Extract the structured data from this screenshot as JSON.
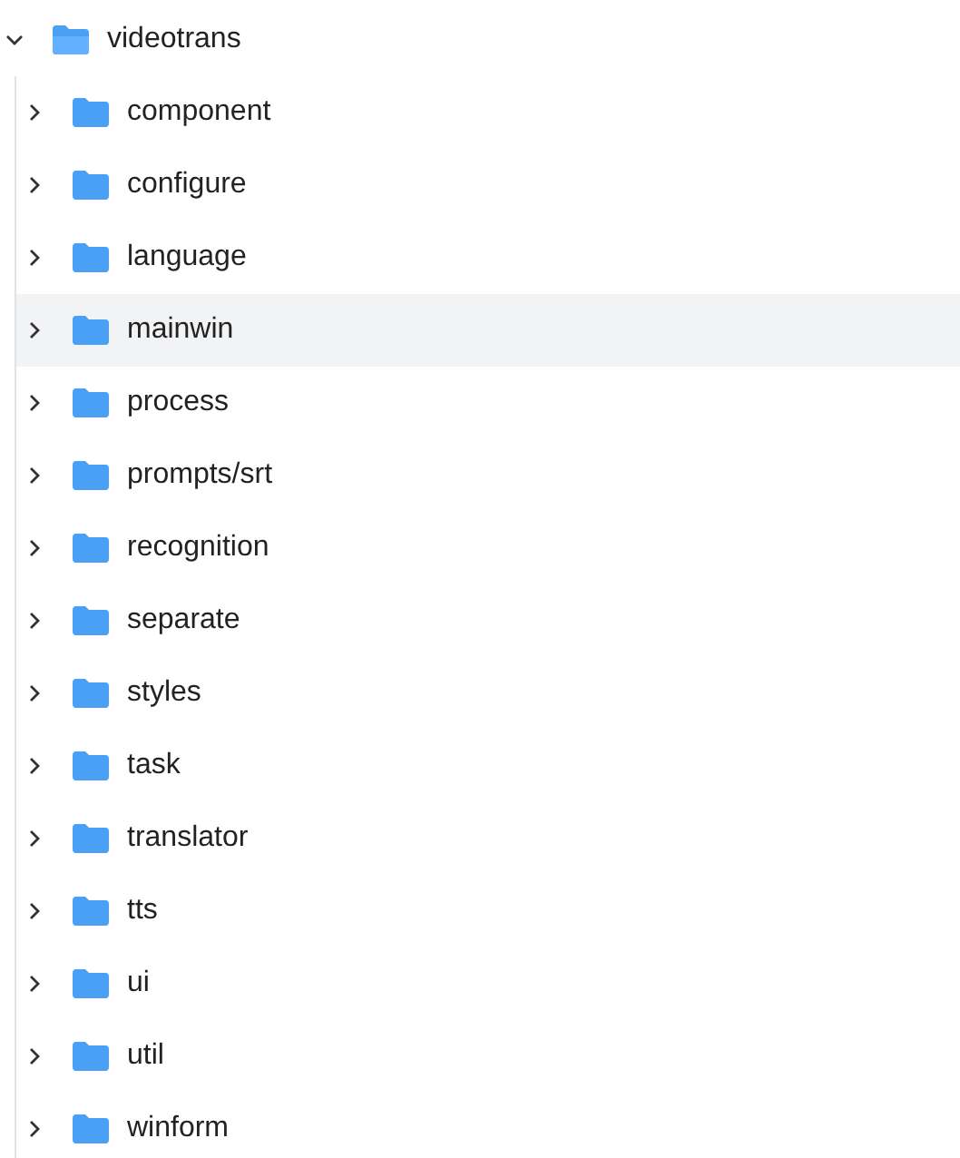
{
  "tree": {
    "label": "videotrans",
    "expanded": true,
    "selected": false,
    "children": [
      {
        "label": "component",
        "expanded": false,
        "selected": false
      },
      {
        "label": "configure",
        "expanded": false,
        "selected": false
      },
      {
        "label": "language",
        "expanded": false,
        "selected": false
      },
      {
        "label": "mainwin",
        "expanded": false,
        "selected": true
      },
      {
        "label": "process",
        "expanded": false,
        "selected": false
      },
      {
        "label": "prompts/srt",
        "expanded": false,
        "selected": false
      },
      {
        "label": "recognition",
        "expanded": false,
        "selected": false
      },
      {
        "label": "separate",
        "expanded": false,
        "selected": false
      },
      {
        "label": "styles",
        "expanded": false,
        "selected": false
      },
      {
        "label": "task",
        "expanded": false,
        "selected": false
      },
      {
        "label": "translator",
        "expanded": false,
        "selected": false
      },
      {
        "label": "tts",
        "expanded": false,
        "selected": false
      },
      {
        "label": "ui",
        "expanded": false,
        "selected": false
      },
      {
        "label": "util",
        "expanded": false,
        "selected": false
      },
      {
        "label": "winform",
        "expanded": false,
        "selected": false
      }
    ]
  }
}
